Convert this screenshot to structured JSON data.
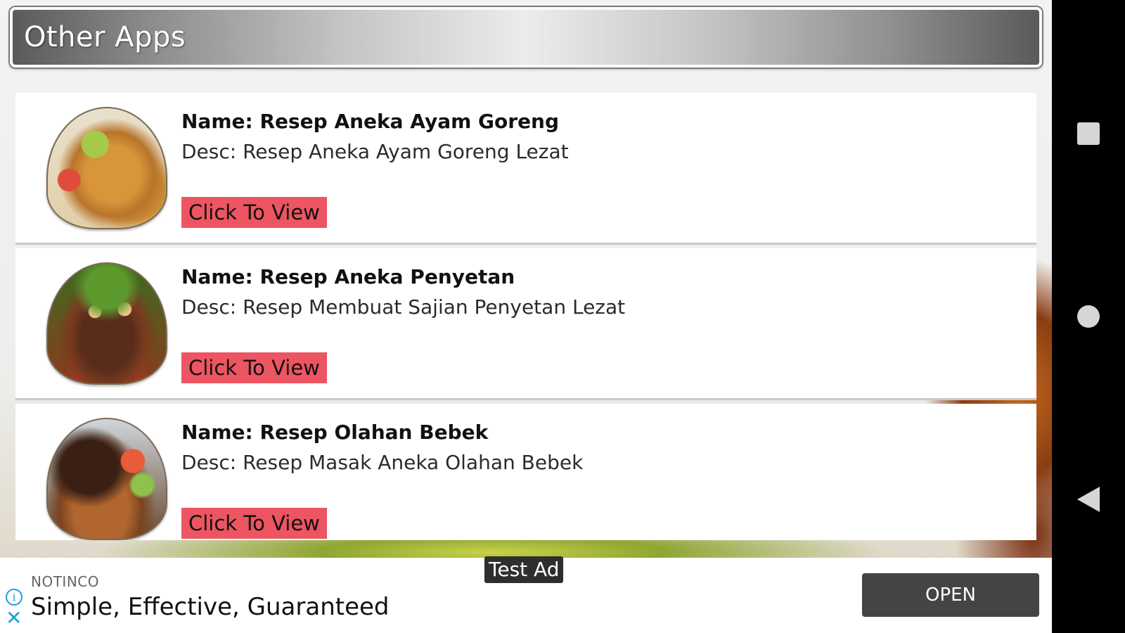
{
  "header": {
    "title": "Other Apps"
  },
  "apps": [
    {
      "name": "Name: Resep Aneka Ayam Goreng",
      "desc": "Desc: Resep Aneka Ayam Goreng Lezat",
      "button": "Click To View"
    },
    {
      "name": "Name: Resep Aneka Penyetan",
      "desc": "Desc: Resep Membuat Sajian Penyetan Lezat",
      "button": "Click To View"
    },
    {
      "name": "Name: Resep Olahan Bebek",
      "desc": "Desc: Resep Masak Aneka Olahan Bebek",
      "button": "Click To View"
    }
  ],
  "ad": {
    "label": "Test Ad",
    "brand": "NOTINCO",
    "headline": "Simple, Effective, Guaranteed",
    "button": "OPEN",
    "info_icon": "info-icon",
    "close_icon": "close-icon"
  },
  "navbar": {
    "icons": [
      "recents-icon",
      "home-icon",
      "back-icon"
    ]
  },
  "colors": {
    "button_bg": "#ec5561",
    "ad_button_bg": "#444444",
    "ad_icon": "#1ba1d6"
  }
}
